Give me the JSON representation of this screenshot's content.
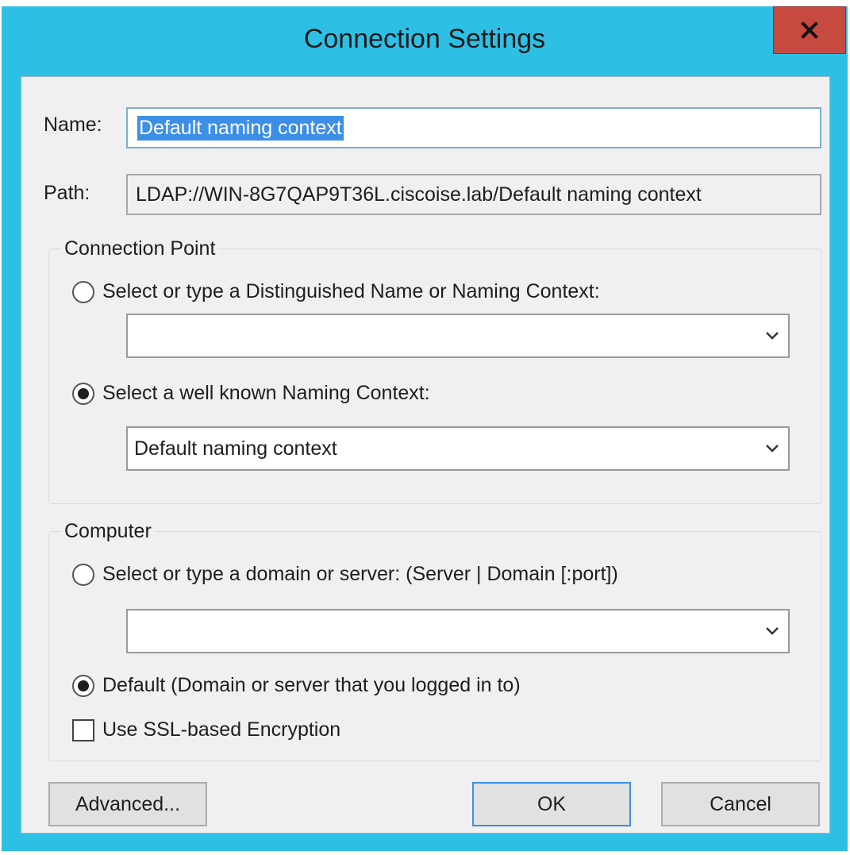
{
  "dialog": {
    "title": "Connection Settings",
    "close_glyph": "x"
  },
  "name": {
    "label": "Name:",
    "value": "Default naming context"
  },
  "path": {
    "label": "Path:",
    "value": "LDAP://WIN-8G7QAP9T36L.ciscoise.lab/Default naming context"
  },
  "connection_point": {
    "title": "Connection Point",
    "option_dn_label": "Select or type a Distinguished Name or Naming Context:",
    "dn_combo_value": "",
    "option_wellknown_label": "Select a well known Naming Context:",
    "wellknown_combo_value": "Default naming context",
    "selected_option": "wellknown"
  },
  "computer": {
    "title": "Computer",
    "option_server_label": "Select or type a domain or server: (Server | Domain [:port])",
    "server_combo_value": "",
    "option_default_label": "Default (Domain or server that you logged in to)",
    "selected_option": "default",
    "ssl_label": "Use SSL-based Encryption",
    "ssl_checked": false
  },
  "buttons": {
    "advanced": "Advanced...",
    "ok": "OK",
    "cancel": "Cancel"
  },
  "colors": {
    "frame": "#2ec0e4",
    "close": "#c74a40",
    "selection": "#3c8ee6"
  },
  "icons": {
    "close": "close-icon",
    "dropdown": "chevron-down-icon"
  }
}
